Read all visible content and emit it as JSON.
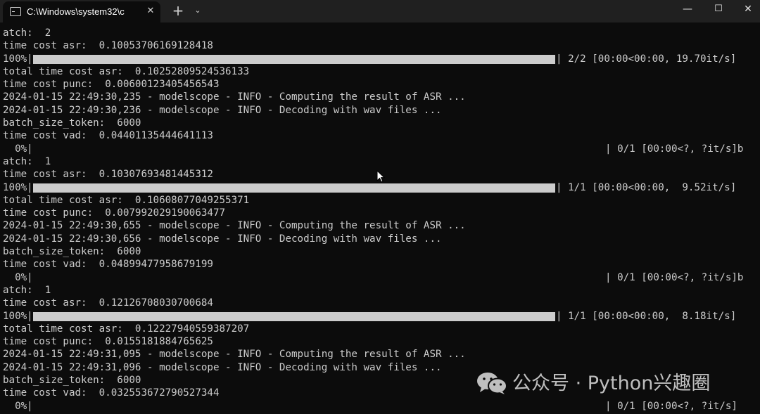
{
  "titlebar": {
    "tab_title": "C:\\Windows\\system32\\c",
    "tab_close": "✕",
    "new_tab": "+",
    "dropdown": "⌄",
    "minimize": "—",
    "maximize": "☐",
    "close": "✕"
  },
  "console": {
    "lines": [
      {
        "type": "text",
        "text": "atch:  2"
      },
      {
        "type": "text",
        "text": "time cost asr:  0.10053706169128418"
      },
      {
        "type": "bar",
        "percent_text": "100%|",
        "progress": 1.0,
        "stats": "| 2/2 [00:00<00:00, 19.70it/s]"
      },
      {
        "type": "text",
        "text": "total time cost asr:  0.10252809524536133"
      },
      {
        "type": "text",
        "text": "time cost punc:  0.00600123405456543"
      },
      {
        "type": "text",
        "text": "2024-01-15 22:49:30,235 - modelscope - INFO - Computing the result of ASR ..."
      },
      {
        "type": "text",
        "text": "2024-01-15 22:49:30,236 - modelscope - INFO - Decoding with wav files ..."
      },
      {
        "type": "text",
        "text": "batch_size_token:  6000"
      },
      {
        "type": "text",
        "text": "time cost vad:  0.04401135444641113"
      },
      {
        "type": "bar",
        "percent_text": "  0%|",
        "progress": 0.0,
        "stats": "| 0/1 [00:00<?, ?it/s]b"
      },
      {
        "type": "text",
        "text": "atch:  1"
      },
      {
        "type": "text",
        "text": "time cost asr:  0.10307693481445312"
      },
      {
        "type": "bar",
        "percent_text": "100%|",
        "progress": 1.0,
        "stats": "| 1/1 [00:00<00:00,  9.52it/s]"
      },
      {
        "type": "text",
        "text": "total time cost asr:  0.10608077049255371"
      },
      {
        "type": "text",
        "text": "time cost punc:  0.007992029190063477"
      },
      {
        "type": "text",
        "text": "2024-01-15 22:49:30,655 - modelscope - INFO - Computing the result of ASR ..."
      },
      {
        "type": "text",
        "text": "2024-01-15 22:49:30,656 - modelscope - INFO - Decoding with wav files ..."
      },
      {
        "type": "text",
        "text": "batch_size_token:  6000"
      },
      {
        "type": "text",
        "text": "time cost vad:  0.04899477958679199"
      },
      {
        "type": "bar",
        "percent_text": "  0%|",
        "progress": 0.0,
        "stats": "| 0/1 [00:00<?, ?it/s]b"
      },
      {
        "type": "text",
        "text": "atch:  1"
      },
      {
        "type": "text",
        "text": "time cost asr:  0.12126708030700684"
      },
      {
        "type": "bar",
        "percent_text": "100%|",
        "progress": 1.0,
        "stats": "| 1/1 [00:00<00:00,  8.18it/s]"
      },
      {
        "type": "text",
        "text": "total time cost asr:  0.12227940559387207"
      },
      {
        "type": "text",
        "text": "time cost punc:  0.0155181884765625"
      },
      {
        "type": "text",
        "text": "2024-01-15 22:49:31,095 - modelscope - INFO - Computing the result of ASR ..."
      },
      {
        "type": "text",
        "text": "2024-01-15 22:49:31,096 - modelscope - INFO - Decoding with wav files ..."
      },
      {
        "type": "text",
        "text": "batch_size_token:  6000"
      },
      {
        "type": "text",
        "text": "time cost vad:  0.032553672790527344"
      },
      {
        "type": "bar",
        "percent_text": "  0%|",
        "progress": 0.0,
        "stats": "| 0/1 [00:00<?, ?it/s]"
      }
    ]
  },
  "watermark": {
    "text": "公众号 · Python兴趣圈",
    "icon": "wechat-icon"
  },
  "colors": {
    "console_bg": "#0c0c0c",
    "console_fg": "#cccccc",
    "titlebar_bg": "#202020"
  }
}
